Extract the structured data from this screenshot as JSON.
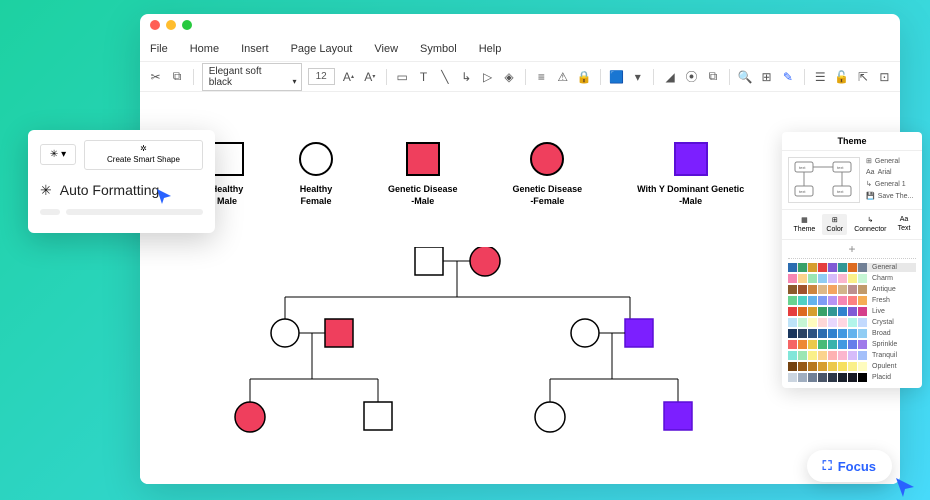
{
  "menu": [
    "File",
    "Home",
    "Insert",
    "Page Layout",
    "View",
    "Symbol",
    "Help"
  ],
  "toolbar": {
    "font": "Elegant soft black",
    "size": "12"
  },
  "popup": {
    "create_smart_shape": "Create Smart Shape",
    "auto_formatting": "Auto Formatting"
  },
  "legend": [
    {
      "shape": "sq",
      "fill": "",
      "label1": "Healthy",
      "label2": "Male"
    },
    {
      "shape": "cir",
      "fill": "",
      "label1": "Healthy",
      "label2": "Female"
    },
    {
      "shape": "sq",
      "fill": "red-fill",
      "label1": "Genetic Disease",
      "label2": "-Male"
    },
    {
      "shape": "cir",
      "fill": "red-fill",
      "label1": "Genetic Disease",
      "label2": "-Female"
    },
    {
      "shape": "sq",
      "fill": "purple-fill",
      "label1": "With Y Dominant Genetic",
      "label2": "-Male"
    }
  ],
  "theme": {
    "title": "Theme",
    "list": [
      "General",
      "Arial",
      "General 1",
      "Save The..."
    ],
    "tabs": [
      "Theme",
      "Color",
      "Connector",
      "Text"
    ],
    "swatches": [
      "General",
      "Charm",
      "Antique",
      "Fresh",
      "Live",
      "Crystal",
      "Broad",
      "Sprinkle",
      "Tranquil",
      "Opulent",
      "Placid"
    ]
  },
  "focus": {
    "label": "Focus"
  },
  "colors": {
    "red": "#ef3f5d",
    "purple": "#7c1fff",
    "accent": "#2962ff"
  }
}
